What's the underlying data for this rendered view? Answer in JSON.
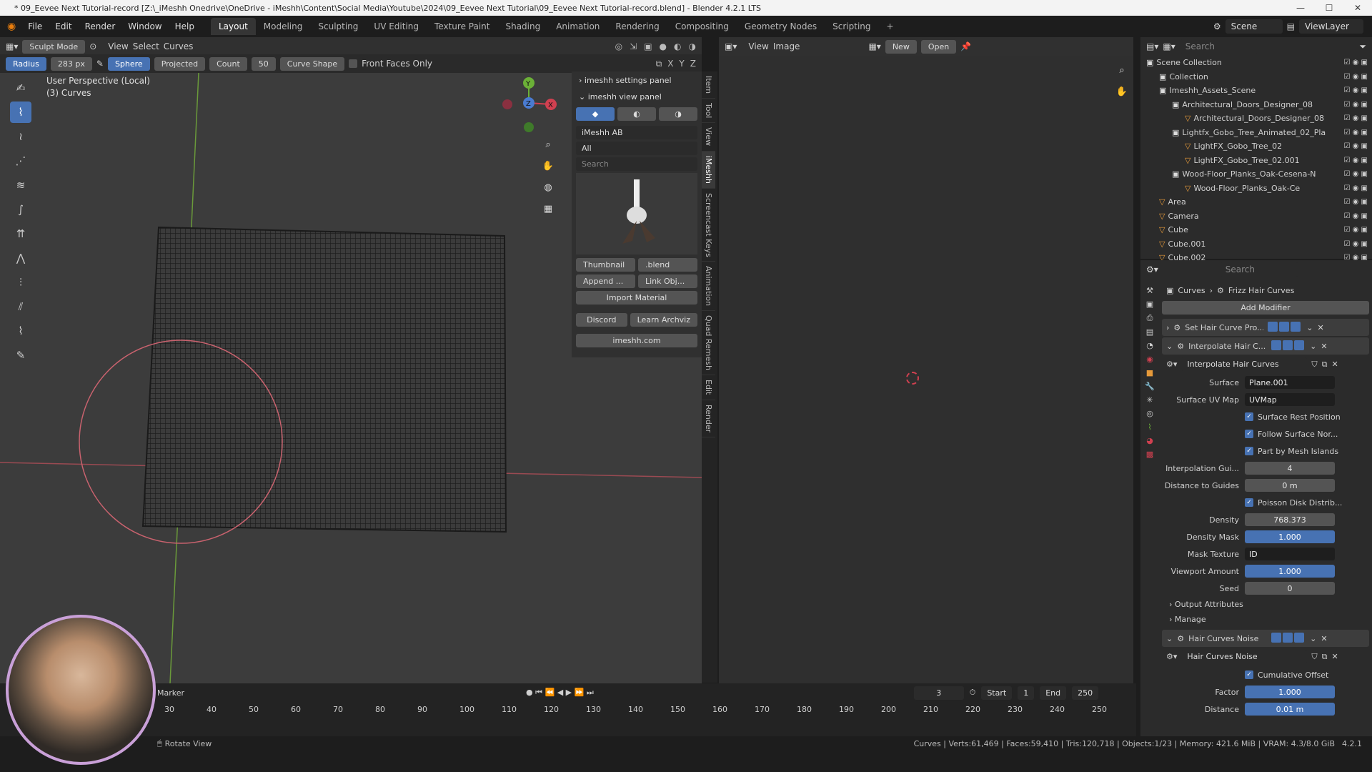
{
  "title_bar": {
    "text": "* 09_Eevee Next Tutorial-record [Z:\\_iMeshh Onedrive\\OneDrive - iMeshh\\Content\\Social Media\\Youtube\\2024\\09_Eevee Next Tutorial\\09_Eevee Next Tutorial-record.blend] - Blender 4.2.1 LTS",
    "minimize": "—",
    "maximize": "☐",
    "close": "✕"
  },
  "menu": [
    "File",
    "Edit",
    "Render",
    "Window",
    "Help"
  ],
  "workspace_tabs": [
    "Layout",
    "Modeling",
    "Sculpting",
    "UV Editing",
    "Texture Paint",
    "Shading",
    "Animation",
    "Rendering",
    "Compositing",
    "Geometry Nodes",
    "Scripting",
    "+"
  ],
  "active_tab": "Layout",
  "scene": {
    "scene_name": "Scene",
    "view_layer": "ViewLayer"
  },
  "viewport_header": {
    "mode": "Sculpt Mode",
    "view": "View",
    "select": "Select",
    "curves": "Curves"
  },
  "tool_settings": {
    "radius_label": "Radius",
    "radius_value": "283 px",
    "sphere": "Sphere",
    "projected": "Projected",
    "count_label": "Count",
    "count_value": "50",
    "curve_shape": "Curve Shape",
    "front_faces": "Front Faces Only"
  },
  "viewport_info": {
    "perspective": "User Perspective (Local)",
    "object": "(3) Curves"
  },
  "axis_labels": {
    "x": "X",
    "y": "Y",
    "z": "Z"
  },
  "imeshh": {
    "settings_panel": "imeshh settings panel",
    "view_panel": "imeshh view panel",
    "library": "iMeshh AB",
    "filter": "All",
    "search_placeholder": "Search",
    "thumbnail": "Thumbnail",
    "blend": ".blend",
    "append": "Append ...",
    "link": "Link Obj...",
    "import_material": "Import Material",
    "discord": "Discord",
    "learn": "Learn Archviz",
    "site": "imeshh.com"
  },
  "sidebar_tabs": [
    "Item",
    "Tool",
    "View",
    "iMeshh",
    "Screencast Keys",
    "Animation",
    "Quad Remesh",
    "Edit",
    "Render"
  ],
  "image_editor": {
    "view": "View",
    "image": "Image",
    "new": "New",
    "open": "Open"
  },
  "outliner": {
    "search_placeholder": "Search",
    "rows": [
      {
        "label": "Scene Collection",
        "indent": 0,
        "icon": "collection"
      },
      {
        "label": "Collection",
        "indent": 1,
        "icon": "collection"
      },
      {
        "label": "Imeshh_Assets_Scene",
        "indent": 1,
        "icon": "collection"
      },
      {
        "label": "Architectural_Doors_Designer_08",
        "indent": 2,
        "icon": "collection"
      },
      {
        "label": "Architectural_Doors_Designer_08",
        "indent": 3,
        "icon": "object"
      },
      {
        "label": "Lightfx_Gobo_Tree_Animated_02_Pla",
        "indent": 2,
        "icon": "collection"
      },
      {
        "label": "LightFX_Gobo_Tree_02",
        "indent": 3,
        "icon": "object"
      },
      {
        "label": "LightFX_Gobo_Tree_02.001",
        "indent": 3,
        "icon": "object"
      },
      {
        "label": "Wood-Floor_Planks_Oak-Cesena-N",
        "indent": 2,
        "icon": "collection"
      },
      {
        "label": "Wood-Floor_Planks_Oak-Ce",
        "indent": 3,
        "icon": "object"
      },
      {
        "label": "Area",
        "indent": 1,
        "icon": "object"
      },
      {
        "label": "Camera",
        "indent": 1,
        "icon": "object"
      },
      {
        "label": "Cube",
        "indent": 1,
        "icon": "object"
      },
      {
        "label": "Cube.001",
        "indent": 1,
        "icon": "object"
      },
      {
        "label": "Cube.002",
        "indent": 1,
        "icon": "object"
      }
    ]
  },
  "properties": {
    "search_placeholder": "Search",
    "breadcrumb": [
      "Curves",
      "Frizz Hair Curves"
    ],
    "add_modifier": "Add Modifier",
    "modifier1": "Set Hair Curve Pro...",
    "modifier2": "Interpolate Hair C...",
    "node_group": "Interpolate Hair Curves",
    "fields": [
      {
        "label": "Surface",
        "value": "Plane.001",
        "style": "dark"
      },
      {
        "label": "Surface UV Map",
        "value": "UVMap",
        "style": "dark"
      }
    ],
    "checks": [
      "Surface Rest Position",
      "Follow Surface Nor...",
      "Part by Mesh Islands"
    ],
    "fields2": [
      {
        "label": "Interpolation Gui...",
        "value": "4",
        "style": "grey"
      },
      {
        "label": "Distance to Guides",
        "value": "0 m",
        "style": "grey"
      }
    ],
    "check2": "Poisson Disk Distrib...",
    "fields3": [
      {
        "label": "Density",
        "value": "768.373",
        "style": "grey"
      },
      {
        "label": "Density Mask",
        "value": "1.000",
        "style": "blue"
      },
      {
        "label": "Mask Texture",
        "value": "ID",
        "style": "dark"
      },
      {
        "label": "Viewport Amount",
        "value": "1.000",
        "style": "blue"
      },
      {
        "label": "Seed",
        "value": "0",
        "style": "grey"
      }
    ],
    "output_attributes": "Output Attributes",
    "manage": "Manage",
    "modifier3": "Hair Curves Noise",
    "node_group3": "Hair Curves Noise",
    "cumulative": "Cumulative Offset",
    "factor_label": "Factor",
    "factor_value": "1.000",
    "distance_label": "Distance",
    "distance_value": "0.01 m"
  },
  "timeline": {
    "current_frame": "3",
    "start_label": "Start",
    "start": "1",
    "end_label": "End",
    "end": "250",
    "marker": "Marker",
    "ticks": [
      "30",
      "40",
      "50",
      "60",
      "70",
      "80",
      "90",
      "100",
      "110",
      "120",
      "130",
      "140",
      "150",
      "160",
      "170",
      "180",
      "190",
      "200",
      "210",
      "220",
      "230",
      "240",
      "250"
    ]
  },
  "status": {
    "rotate": "Rotate View",
    "stats": "Curves | Verts:61,469 | Faces:59,410 | Tris:120,718 | Objects:1/23 | Memory: 421.6 MiB | VRAM: 4.3/8.0 GiB",
    "version": "4.2.1"
  }
}
